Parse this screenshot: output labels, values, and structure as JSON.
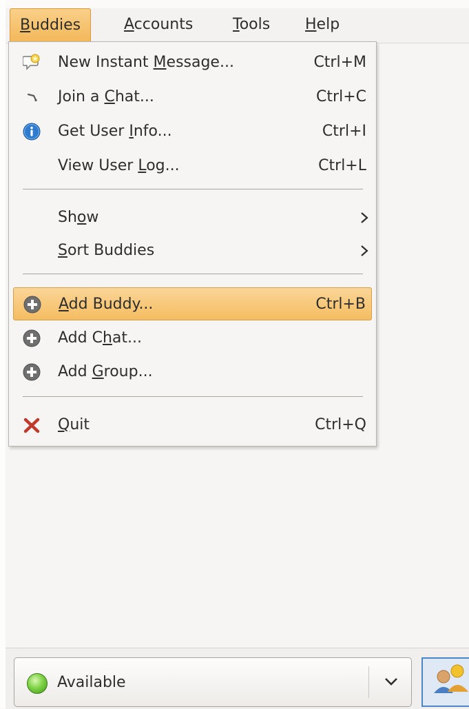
{
  "menubar": {
    "items": [
      {
        "label": "Buddies",
        "mnemonic": "B",
        "rest": "uddies"
      },
      {
        "label": "Accounts",
        "mnemonic": "A",
        "rest": "ccounts"
      },
      {
        "label": "Tools",
        "mnemonic": "T",
        "rest": "ools"
      },
      {
        "label": "Help",
        "mnemonic": "H",
        "rest": "elp"
      }
    ]
  },
  "menu": {
    "items": [
      {
        "pre": "New Instant ",
        "mn": "M",
        "post": "essage...",
        "accel": "Ctrl+M",
        "icon": "new-message-icon"
      },
      {
        "pre": "Join a ",
        "mn": "C",
        "post": "hat...",
        "accel": "Ctrl+C",
        "icon": "join-chat-icon"
      },
      {
        "pre": "Get User ",
        "mn": "I",
        "post": "nfo...",
        "accel": "Ctrl+I",
        "icon": "info-icon"
      },
      {
        "pre": "View User ",
        "mn": "L",
        "post": "og...",
        "accel": "Ctrl+L",
        "icon": ""
      },
      {
        "pre": "Sh",
        "mn": "o",
        "post": "w",
        "accel": "",
        "icon": ""
      },
      {
        "pre": "",
        "mn": "S",
        "post": "ort Buddies",
        "accel": "",
        "icon": ""
      },
      {
        "pre": "",
        "mn": "A",
        "post": "dd Buddy...",
        "accel": "Ctrl+B",
        "icon": "add-icon"
      },
      {
        "pre": "Add C",
        "mn": "h",
        "post": "at...",
        "accel": "",
        "icon": "add-icon"
      },
      {
        "pre": "Add ",
        "mn": "G",
        "post": "roup...",
        "accel": "",
        "icon": "add-icon"
      },
      {
        "pre": "",
        "mn": "Q",
        "post": "uit",
        "accel": "Ctrl+Q",
        "icon": "quit-icon"
      }
    ]
  },
  "statusbar": {
    "status": "Available",
    "status_icon": "available-icon",
    "buddy_icon": "buddy-icon"
  },
  "colors": {
    "highlight": "#f5bd62",
    "available": "#7fd244",
    "quit": "#c0392b",
    "info": "#2f7bd0"
  }
}
